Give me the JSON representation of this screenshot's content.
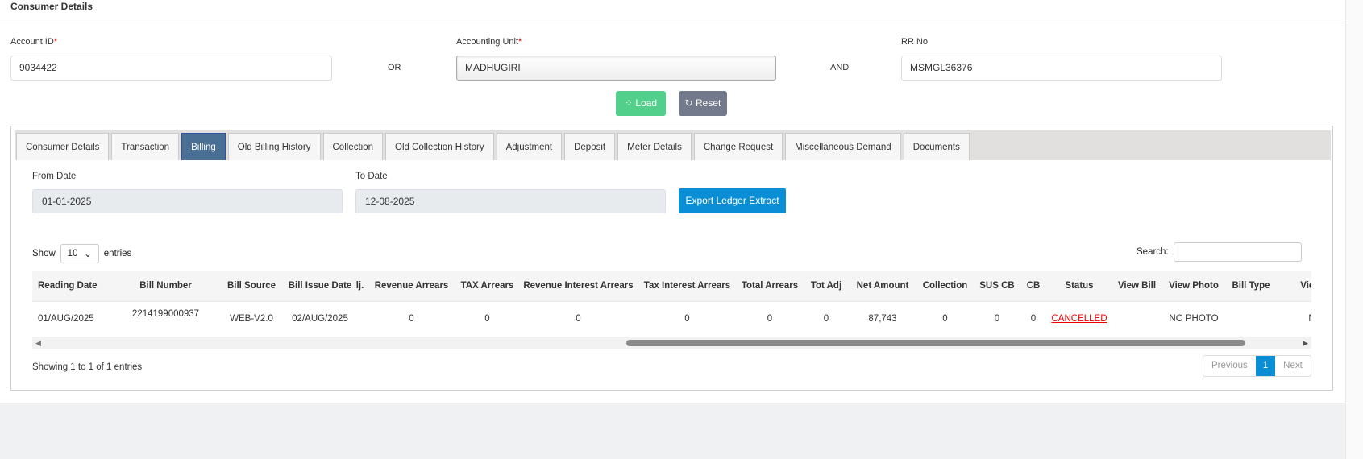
{
  "header": {
    "title": "Consumer Details"
  },
  "form": {
    "account_id_label": "Account ID",
    "required_mark": "*",
    "account_id_value": "9034422",
    "or_label": "OR",
    "accounting_unit_label": "Accounting Unit",
    "accounting_unit_value": "MADHUGIRI",
    "and_label": "AND",
    "rr_no_label": "RR No",
    "rr_no_value": "MSMGL36376",
    "load_label": "Load",
    "reset_label": "Reset"
  },
  "tabs": [
    "Consumer Details",
    "Transaction",
    "Billing",
    "Old Billing History",
    "Collection",
    "Old Collection History",
    "Adjustment",
    "Deposit",
    "Meter Details",
    "Change Request",
    "Miscellaneous Demand",
    "Documents"
  ],
  "active_tab": "Billing",
  "billing": {
    "from_date_label": "From Date",
    "from_date_value": "01-01-2025",
    "to_date_label": "To Date",
    "to_date_value": "12-08-2025",
    "export_label": "Export Ledger Extract",
    "show_label": "Show",
    "entries_value": "10",
    "entries_label": "entries",
    "search_label": "Search:",
    "columns": [
      "Reading Date",
      "Bill Number",
      "Bill Source",
      "Bill Issue Date",
      "lj.",
      "Revenue Arrears",
      "TAX Arrears",
      "Revenue Interest Arrears",
      "Tax Interest Arrears",
      "Total Arrears",
      "Tot Adj",
      "Net Amount",
      "Collection",
      "SUS CB",
      "CB",
      "Status",
      "View Bill",
      "View Photo",
      "Bill Type",
      "View C"
    ],
    "rows": [
      [
        "01/AUG/2025",
        "2214199000937",
        "WEB-V2.0",
        "02/AUG/2025",
        "",
        "0",
        "0",
        "0",
        "0",
        "0",
        "0",
        "87,743",
        "0",
        "0",
        "0",
        "CANCELLED",
        "",
        "NO PHOTO",
        "",
        "NO"
      ]
    ],
    "info": "Showing 1 to 1 of 1 entries",
    "pagination": {
      "previous": "Previous",
      "page": "1",
      "next": "Next"
    }
  }
}
